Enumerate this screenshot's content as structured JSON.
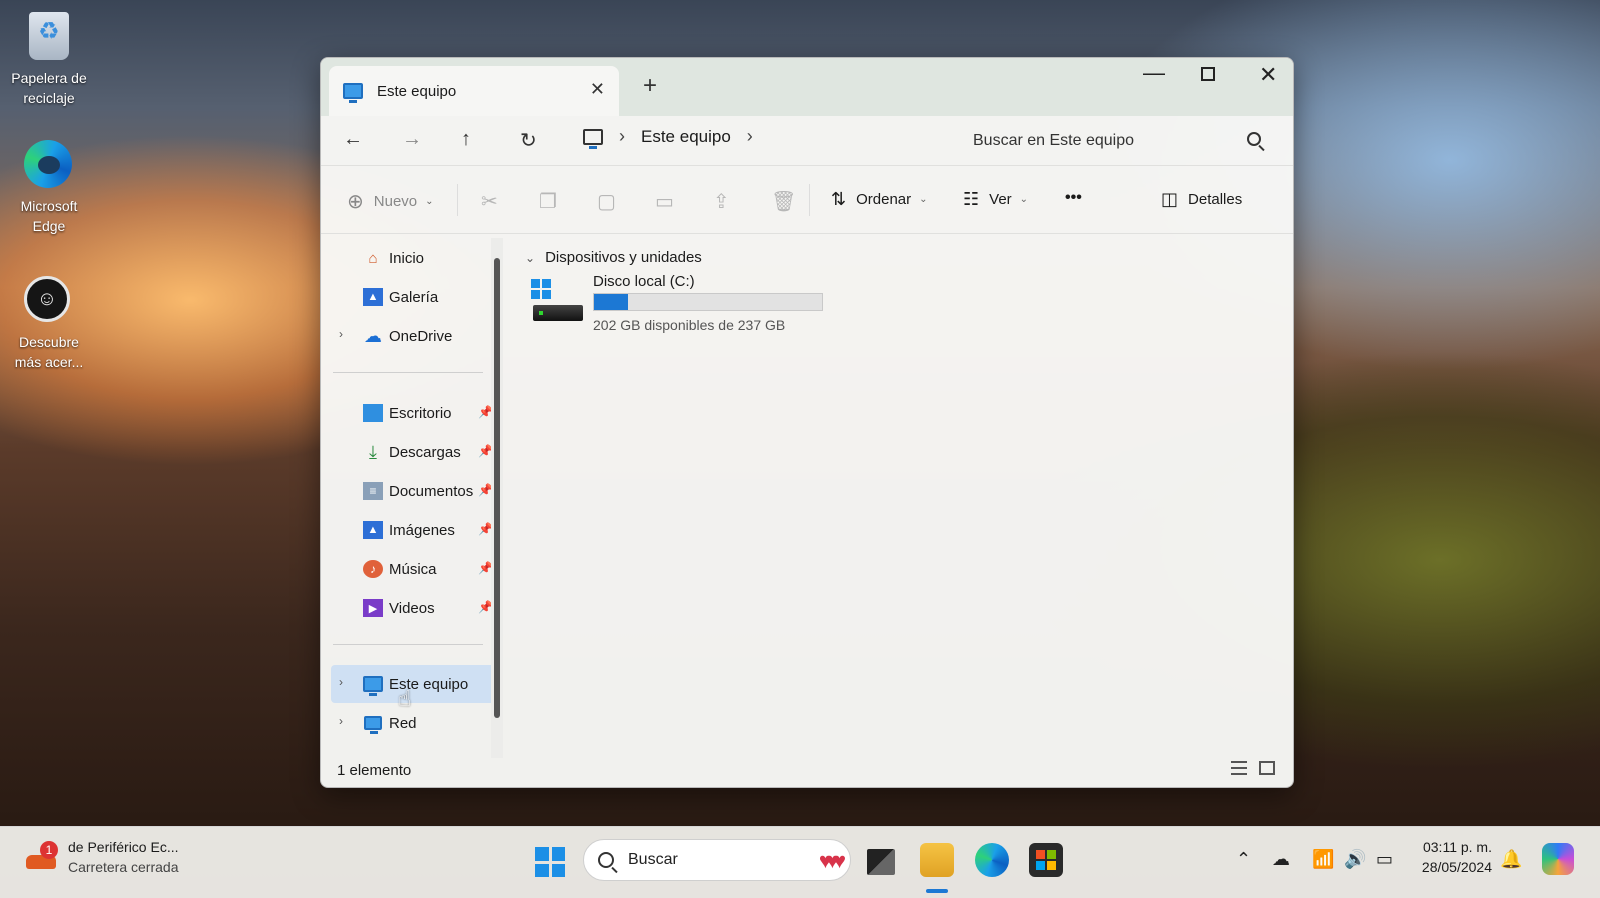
{
  "desktop": {
    "icons": [
      {
        "label": "Papelera de reciclaje",
        "icon": "recycle-bin-icon"
      },
      {
        "label": "Microsoft Edge",
        "icon": "edge-icon"
      },
      {
        "label": "Descubre más acer...",
        "icon": "acer-icon"
      }
    ]
  },
  "window": {
    "tab_title": "Este equipo",
    "new_tab": "+",
    "breadcrumb": [
      "Este equipo"
    ],
    "search_placeholder": "Buscar en Este equipo"
  },
  "toolbar": {
    "new_label": "Nuevo",
    "sort_label": "Ordenar",
    "view_label": "Ver",
    "more_label": "•••",
    "details_label": "Detalles"
  },
  "sidebar": {
    "items": [
      {
        "label": "Inicio",
        "icon": "home-icon"
      },
      {
        "label": "Galería",
        "icon": "gallery-icon"
      },
      {
        "label": "OneDrive",
        "icon": "onedrive-icon"
      },
      {
        "label": "Escritorio",
        "icon": "desktop-folder-icon"
      },
      {
        "label": "Descargas",
        "icon": "downloads-icon"
      },
      {
        "label": "Documentos",
        "icon": "documents-icon"
      },
      {
        "label": "Imágenes",
        "icon": "pictures-icon"
      },
      {
        "label": "Música",
        "icon": "music-icon"
      },
      {
        "label": "Videos",
        "icon": "videos-icon"
      },
      {
        "label": "Este equipo",
        "icon": "this-pc-icon"
      },
      {
        "label": "Red",
        "icon": "network-icon"
      }
    ]
  },
  "content": {
    "group_header": "Dispositivos y unidades",
    "drive": {
      "name": "Disco local (C:)",
      "space": "202 GB disponibles de 237 GB",
      "used_fraction": 0.148
    }
  },
  "status": {
    "count": "1 elemento"
  },
  "taskbar": {
    "weather_title": "de Periférico Ec...",
    "weather_sub": "Carretera cerrada",
    "weather_badge": "1",
    "search_label": "Buscar",
    "time": "03:11 p. m.",
    "date": "28/05/2024"
  },
  "colors": {
    "accent": "#1c78d4",
    "selected": "#cfe0f3"
  }
}
